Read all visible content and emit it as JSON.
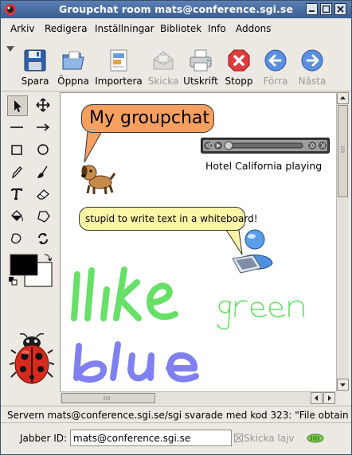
{
  "window": {
    "title": "Groupchat room mats@conference.sgi.se"
  },
  "menubar": {
    "items": [
      "Arkiv",
      "Redigera",
      "Inställningar",
      "Bibliotek",
      "Info",
      "Addons"
    ]
  },
  "toolbar": {
    "buttons": [
      {
        "label": "Spara",
        "icon": "floppy-disk-icon",
        "enabled": true
      },
      {
        "label": "Öppna",
        "icon": "open-folder-icon",
        "enabled": true
      },
      {
        "label": "Importera",
        "icon": "import-document-icon",
        "enabled": true
      },
      {
        "label": "Skicka",
        "icon": "send-envelope-icon",
        "enabled": false
      },
      {
        "label": "Utskrift",
        "icon": "printer-icon",
        "enabled": true
      },
      {
        "label": "Stopp",
        "icon": "stop-icon",
        "enabled": true
      },
      {
        "label": "Förra",
        "icon": "arrow-left-icon",
        "enabled": false
      },
      {
        "label": "Nästa",
        "icon": "arrow-right-icon",
        "enabled": false
      }
    ]
  },
  "palette": {
    "tools": [
      "pointer",
      "move",
      "line",
      "arrow",
      "rectangle",
      "oval",
      "pencil",
      "brush",
      "text",
      "eraser",
      "paint-bucket",
      "polygon",
      "freeform-shape",
      "rotate"
    ],
    "foreground_color": "#000000",
    "background_color": "#ffffff"
  },
  "canvas": {
    "title_bubble": "My groupchat",
    "player_caption": "Hotel California playing",
    "text_bubble": "stupid to write text in a whiteboard!",
    "drawings": [
      {
        "text": "Ilike",
        "color": "#66e066"
      },
      {
        "text": "green",
        "color": "#66e066"
      },
      {
        "text": "blue",
        "color": "#8080f0"
      }
    ]
  },
  "status": {
    "message": "Servern mats@conference.sgi.se/sgi svarade med kod 323: \"File obtain"
  },
  "bottom": {
    "jid_label": "Jabber ID:",
    "jid_value": "mats@conference.sgi.se",
    "send_live_label": "Skicka lajv"
  },
  "colors": {
    "titlebar": "#4a6ea4",
    "title_bubble": "#f7a060",
    "text_bubble": "#fbf6a6"
  }
}
